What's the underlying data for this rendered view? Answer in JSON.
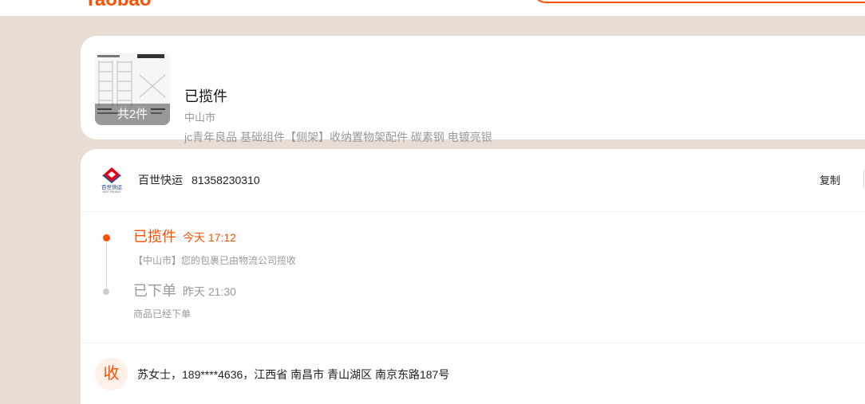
{
  "header": {
    "logo_text": "Taobao"
  },
  "colors": {
    "accent": "#ff5000",
    "page_background": "#e8ddd5",
    "card_background": "#ffffff",
    "inactive_text": "#999999",
    "recipient_badge_background": "#fff0ea"
  },
  "order": {
    "status": "已揽件",
    "city": "中山市",
    "product_title": "jc青年良品 基础组件【侧架】收纳置物架配件 碳素钢 电镀亮银",
    "item_count": "共2件"
  },
  "shipment": {
    "logo_text": "百世快运",
    "logo_subtext": "BEST FREIGHT",
    "courier": "百世快运",
    "tracking_number": "81358230310",
    "copy_label": "复制",
    "events": [
      {
        "title": "已揽件",
        "time": "今天 17:12",
        "detail": "【中山市】您的包裹已由物流公司揽收",
        "active": true
      },
      {
        "title": "已下单",
        "time": "昨天 21:30",
        "detail": "商品已经下单",
        "active": false
      }
    ]
  },
  "recipient": {
    "badge": "收",
    "info": "苏女士，189****4636，江西省 南昌市 青山湖区 南京东路187号"
  },
  "icons": {
    "courier_logo": "best-express-logo",
    "timeline_active": "orange-dot-icon",
    "timeline_idle": "gray-dot-icon"
  }
}
